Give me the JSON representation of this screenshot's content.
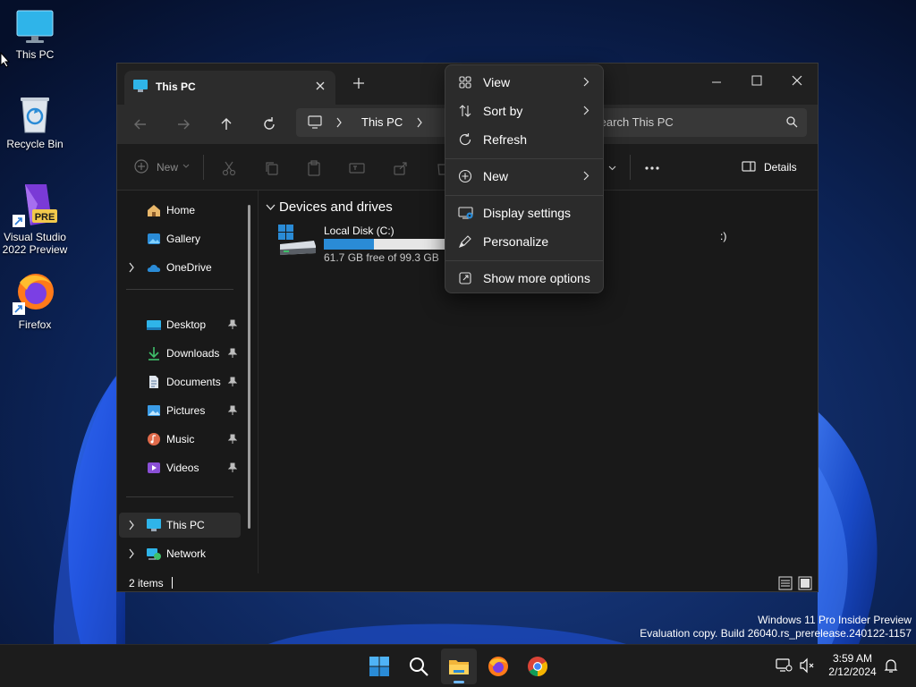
{
  "desktop": {
    "icons": [
      {
        "label": "This PC"
      },
      {
        "label": "Recycle Bin"
      },
      {
        "label_line1": "Visual Studio",
        "label_line2": "2022 Preview",
        "badge": "PRE"
      },
      {
        "label": "Firefox"
      }
    ]
  },
  "explorer": {
    "tab_title": "This PC",
    "address": {
      "crumb": "This PC"
    },
    "search": {
      "placeholder": "Search This PC"
    },
    "cmdbar": {
      "new_label": "New",
      "details_label": "Details",
      "more_label": "..."
    },
    "nav": {
      "top": [
        {
          "label": "Home"
        },
        {
          "label": "Gallery"
        },
        {
          "label": "OneDrive"
        }
      ],
      "pinned": [
        {
          "label": "Desktop"
        },
        {
          "label": "Downloads"
        },
        {
          "label": "Documents"
        },
        {
          "label": "Pictures"
        },
        {
          "label": "Music"
        },
        {
          "label": "Videos"
        }
      ],
      "bottom": [
        {
          "label": "This PC"
        },
        {
          "label": "Network"
        }
      ]
    },
    "content": {
      "group_header": "Devices and drives",
      "drives": [
        {
          "name": "Local Disk (C:)",
          "free_text": "61.7 GB free of 99.3 GB",
          "used_fraction": 0.38
        }
      ],
      "partial_drive_text": ":)"
    },
    "status": {
      "item_count": "2 items"
    }
  },
  "context_menu": {
    "items": [
      {
        "label": "View",
        "icon": "grid-view-icon",
        "submenu": true
      },
      {
        "label": "Sort by",
        "icon": "sort-icon",
        "submenu": true
      },
      {
        "label": "Refresh",
        "icon": "refresh-icon",
        "submenu": false
      },
      {
        "label": "New",
        "icon": "new-plus-icon",
        "submenu": true
      },
      {
        "label": "Display settings",
        "icon": "display-settings-icon",
        "submenu": false
      },
      {
        "label": "Personalize",
        "icon": "pen-icon",
        "submenu": false
      },
      {
        "label": "Show more options",
        "icon": "more-options-icon",
        "submenu": false
      }
    ]
  },
  "watermark": {
    "line1": "Windows 11 Pro Insider Preview",
    "line2": "Evaluation copy. Build 26040.rs_prerelease.240122-1157"
  },
  "taskbar": {
    "clock_time": "3:59 AM",
    "clock_date": "2/12/2024"
  },
  "colors": {
    "accent": "#2a8bd6",
    "menu_bg": "#2b2b2b",
    "window_bg": "#191919",
    "taskbar_bg": "#1c1c1c"
  }
}
